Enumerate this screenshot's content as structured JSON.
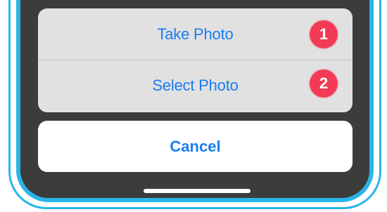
{
  "action_sheet": {
    "actions": [
      {
        "label": "Take Photo"
      },
      {
        "label": "Select Photo"
      }
    ],
    "cancel_label": "Cancel"
  },
  "callouts": [
    {
      "number": "1"
    },
    {
      "number": "2"
    }
  ],
  "colors": {
    "accent": "#1a7cf1",
    "frame": "#29b5e8",
    "badge": "#f33a55",
    "screen": "#3c3c3c",
    "sheet": "#e1e1e1"
  }
}
